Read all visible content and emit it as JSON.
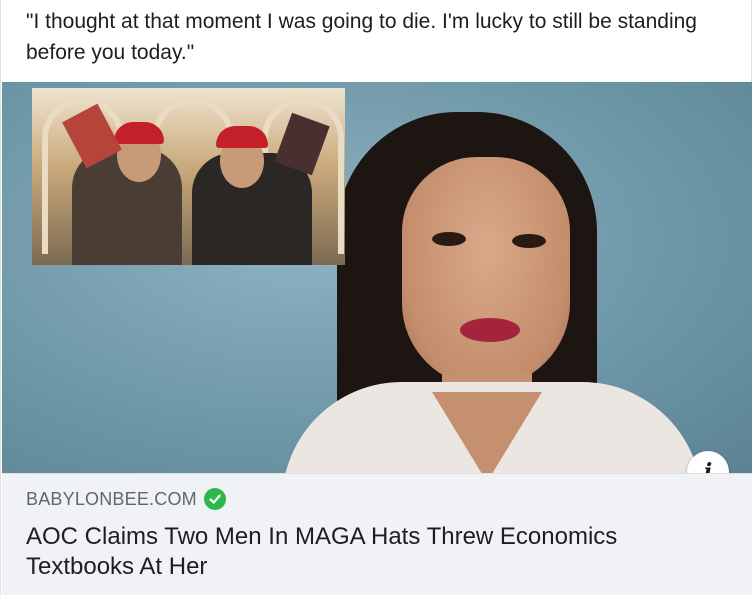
{
  "post": {
    "caption": "\"I thought at that moment I was going to die. I'm lucky to still be standing before you today.\""
  },
  "link_preview": {
    "domain": "BABYLONBEE.COM",
    "verified_icon": "check-circle-icon",
    "headline": "AOC Claims Two Men In MAGA Hats Threw Economics Textbooks At Her",
    "info_icon": "info-icon"
  },
  "colors": {
    "verified": "#2db84d",
    "link_bar_bg": "#f0f2f5"
  }
}
